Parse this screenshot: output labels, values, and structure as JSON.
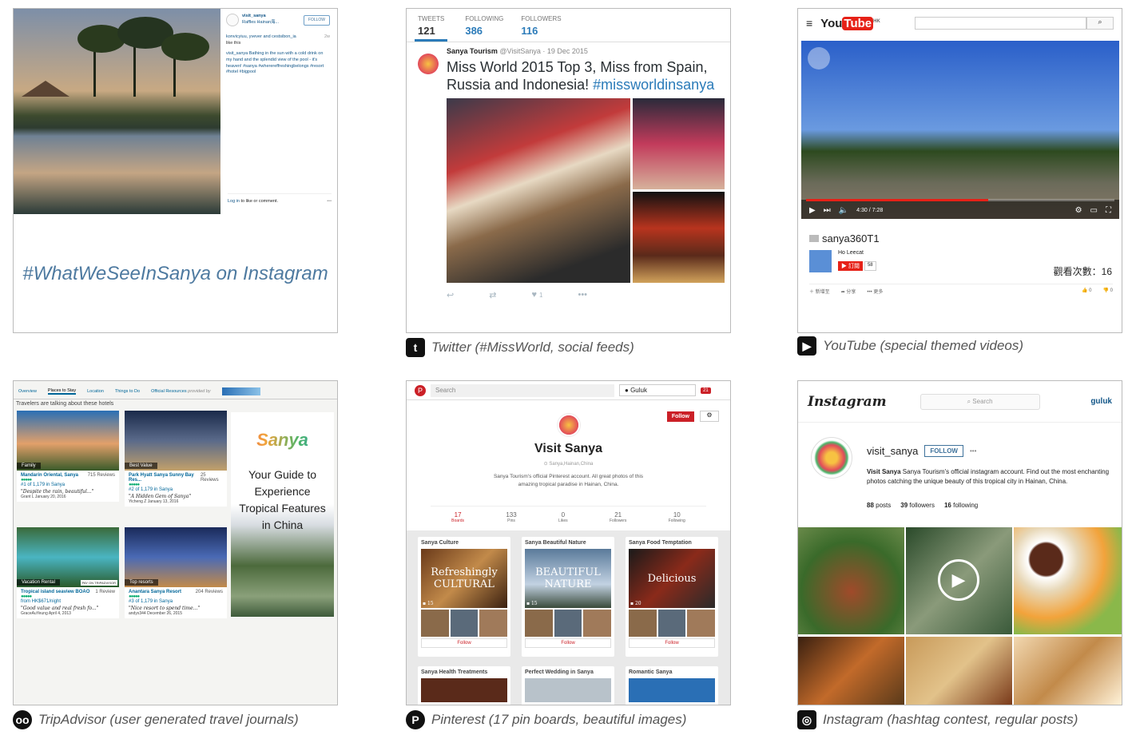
{
  "instagram_post": {
    "username": "visit_sanya",
    "location": "Raffles Hainan海...",
    "follow": "FOLLOW",
    "likers": "konvicyiuu, yvever and cestsibon_ia",
    "likers_suffix": "like this",
    "age": "2w",
    "caption_user": "visit_sanya",
    "caption": "Bathing in the sun with a cold drink on my hand and the splendid view of the pool - it's heaven! #sanya #wherereffreshingbelongs #resort #hotel #bigpool",
    "login": "Log in",
    "login_suffix": "to like or comment.",
    "more": "•••",
    "hashtag": "#WhatWeSeeInSanya on Instagram"
  },
  "twitter": {
    "stats": [
      {
        "label": "TWEETS",
        "value": "121"
      },
      {
        "label": "FOLLOWING",
        "value": "386"
      },
      {
        "label": "FOLLOWERS",
        "value": "116"
      }
    ],
    "name": "Sanya Tourism",
    "handle": "@VisitSanya · 19 Dec 2015",
    "text": "Miss World 2015 Top 3, Miss from Spain, Russia and Indonesia!",
    "hashtag": "#missworldinsanya",
    "like_count": "1",
    "caption": "Twitter (#MissWorld, social feeds)"
  },
  "youtube": {
    "logo_you": "You",
    "logo_tube": "Tube",
    "region": "HK",
    "time": "4:30 / 7:28",
    "progress": 0.59,
    "title": "sanya360T1",
    "channel": "Ho Leecat",
    "subscribe": "訂閱",
    "subs": "58",
    "views": "觀看次數：16",
    "actions": [
      "新增至",
      "分享",
      "更多"
    ],
    "likes": "0",
    "dislikes": "0",
    "caption": "YouTube (special themed videos)"
  },
  "tripadvisor": {
    "tabs": [
      "Overview",
      "Places to Stay",
      "Location",
      "Things to Do",
      "Official Resources"
    ],
    "provided": "provided by",
    "heading": "Travelers are talking about these hotels",
    "hotels": [
      {
        "tag": "Family",
        "name": "Mandarin Oriental, Sanya",
        "reviews": "715 Reviews",
        "rank": "#1 of 1,179 in Sanya",
        "quote": "\"Despite the rain, beautiful...\"",
        "user": "Grant L",
        "date": "January 20, 2016"
      },
      {
        "tag": "Best Value",
        "name": "Park Hyatt Sanya Sunny Bay Res...",
        "reviews": "25 Reviews",
        "rank": "#2 of 1,179 in Sanya",
        "quote": "\"A Hidden Gem of Sanya\"",
        "user": "Yicheng Z",
        "date": "January 13, 2016"
      },
      {
        "tag": "Vacation Rental",
        "badge": "PAY ON TRIPADVISOR",
        "name": "Tropical island seaview BOAO",
        "reviews": "1 Review",
        "rank": "from HK$671/night",
        "quote": "\"Good value and real fresh fo...\"",
        "user": "GraceAuYeung",
        "date": "April 4, 2013"
      },
      {
        "tag": "Top resorts",
        "name": "Anantara Sanya Resort",
        "reviews": "204 Reviews",
        "rank": "#3 of 1,179 in Sanya",
        "quote": "\"Nice resort to spend time...\"",
        "user": "andyx344",
        "date": "December 26, 2015"
      }
    ],
    "ad_logo": "Sanya",
    "ad_text": "Your Guide to Experience Tropical Features in China",
    "caption": "TripAdvisor (user generated travel journals)"
  },
  "pinterest": {
    "search": "Search",
    "user": "Guluk",
    "notif": "21",
    "follow": "Follow",
    "title": "Visit Sanya",
    "location": "Sanya,Hainan,China",
    "desc": "Sanya Tourism's official Pinterest account. All great photos of this amazing tropical paradise in Hainan, China.",
    "stats": [
      {
        "value": "17",
        "label": "Boards"
      },
      {
        "value": "133",
        "label": "Pins"
      },
      {
        "value": "0",
        "label": "Likes"
      },
      {
        "value": "21",
        "label": "Followers"
      },
      {
        "value": "10",
        "label": "Following"
      }
    ],
    "boards": [
      {
        "name": "Sanya Culture",
        "cover": "Refreshingly CULTURAL",
        "count": "15",
        "follow": "Follow"
      },
      {
        "name": "Sanya Beautiful Nature",
        "cover": "BEAUTIFUL NATURE",
        "count": "15",
        "follow": "Follow"
      },
      {
        "name": "Sanya Food Temptation",
        "cover": "Delicious",
        "count": "20",
        "follow": "Follow"
      }
    ],
    "boards2": [
      "Sanya Health Treatments",
      "Perfect Wedding in Sanya",
      "Romantic Sanya"
    ],
    "caption": "Pinterest (17 pin boards, beautiful images)"
  },
  "instagram_profile": {
    "logo": "Instagram",
    "search": "Search",
    "user": "guluk",
    "username": "visit_sanya",
    "follow": "FOLLOW",
    "more": "•••",
    "bio_name": "Visit Sanya",
    "bio": "Sanya Tourism's official instagram account. Find out the most enchanting photos catching the unique beauty of this tropical city in Hainan, China.",
    "posts": "88",
    "posts_label": "posts",
    "followers": "39",
    "followers_label": "followers",
    "following": "16",
    "following_label": "following",
    "caption": "Instagram (hashtag contest, regular posts)"
  }
}
